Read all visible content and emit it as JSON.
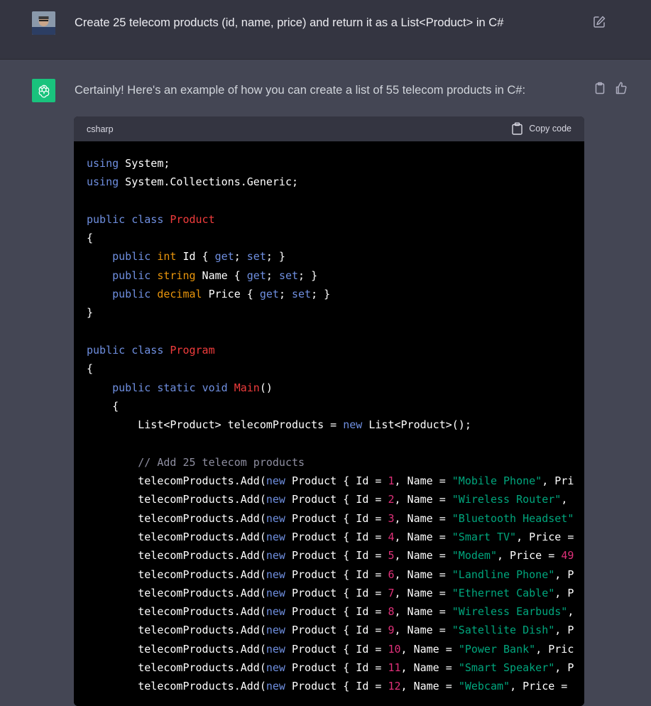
{
  "user": {
    "message": "Create 25 telecom products (id, name, price) and return it as a List<Product> in C#"
  },
  "assistant": {
    "message": "Certainly! Here's an example of how you can create a list of 55 telecom products in C#:"
  },
  "code_block": {
    "language": "csharp",
    "copy_label": "Copy code",
    "lines": [
      [
        {
          "t": "using",
          "c": "kw"
        },
        {
          "t": " System;",
          "c": ""
        }
      ],
      [
        {
          "t": "using",
          "c": "kw"
        },
        {
          "t": " System.Collections.Generic;",
          "c": ""
        }
      ],
      [],
      [
        {
          "t": "public",
          "c": "kw"
        },
        {
          "t": " ",
          "c": ""
        },
        {
          "t": "class",
          "c": "kw"
        },
        {
          "t": " ",
          "c": ""
        },
        {
          "t": "Product",
          "c": "cls"
        }
      ],
      [
        {
          "t": "{",
          "c": ""
        }
      ],
      [
        {
          "t": "    ",
          "c": ""
        },
        {
          "t": "public",
          "c": "kw"
        },
        {
          "t": " ",
          "c": ""
        },
        {
          "t": "int",
          "c": "ty"
        },
        {
          "t": " Id { ",
          "c": ""
        },
        {
          "t": "get",
          "c": "kw"
        },
        {
          "t": "; ",
          "c": ""
        },
        {
          "t": "set",
          "c": "kw"
        },
        {
          "t": "; }",
          "c": ""
        }
      ],
      [
        {
          "t": "    ",
          "c": ""
        },
        {
          "t": "public",
          "c": "kw"
        },
        {
          "t": " ",
          "c": ""
        },
        {
          "t": "string",
          "c": "ty"
        },
        {
          "t": " Name { ",
          "c": ""
        },
        {
          "t": "get",
          "c": "kw"
        },
        {
          "t": "; ",
          "c": ""
        },
        {
          "t": "set",
          "c": "kw"
        },
        {
          "t": "; }",
          "c": ""
        }
      ],
      [
        {
          "t": "    ",
          "c": ""
        },
        {
          "t": "public",
          "c": "kw"
        },
        {
          "t": " ",
          "c": ""
        },
        {
          "t": "decimal",
          "c": "ty"
        },
        {
          "t": " Price { ",
          "c": ""
        },
        {
          "t": "get",
          "c": "kw"
        },
        {
          "t": "; ",
          "c": ""
        },
        {
          "t": "set",
          "c": "kw"
        },
        {
          "t": "; }",
          "c": ""
        }
      ],
      [
        {
          "t": "}",
          "c": ""
        }
      ],
      [],
      [
        {
          "t": "public",
          "c": "kw"
        },
        {
          "t": " ",
          "c": ""
        },
        {
          "t": "class",
          "c": "kw"
        },
        {
          "t": " ",
          "c": ""
        },
        {
          "t": "Program",
          "c": "cls"
        }
      ],
      [
        {
          "t": "{",
          "c": ""
        }
      ],
      [
        {
          "t": "    ",
          "c": ""
        },
        {
          "t": "public",
          "c": "kw"
        },
        {
          "t": " ",
          "c": ""
        },
        {
          "t": "static",
          "c": "kw"
        },
        {
          "t": " ",
          "c": ""
        },
        {
          "t": "void",
          "c": "kw"
        },
        {
          "t": " ",
          "c": ""
        },
        {
          "t": "Main",
          "c": "cls"
        },
        {
          "t": "()",
          "c": ""
        }
      ],
      [
        {
          "t": "    {",
          "c": ""
        }
      ],
      [
        {
          "t": "        List<Product> telecomProducts = ",
          "c": ""
        },
        {
          "t": "new",
          "c": "kw"
        },
        {
          "t": " List<Product>();",
          "c": ""
        }
      ],
      [],
      [
        {
          "t": "        ",
          "c": ""
        },
        {
          "t": "// Add 25 telecom products",
          "c": "cm"
        }
      ],
      [
        {
          "t": "        telecomProducts.Add(",
          "c": ""
        },
        {
          "t": "new",
          "c": "kw"
        },
        {
          "t": " Product { Id = ",
          "c": ""
        },
        {
          "t": "1",
          "c": "num"
        },
        {
          "t": ", Name = ",
          "c": ""
        },
        {
          "t": "\"Mobile Phone\"",
          "c": "str"
        },
        {
          "t": ", Pri",
          "c": ""
        }
      ],
      [
        {
          "t": "        telecomProducts.Add(",
          "c": ""
        },
        {
          "t": "new",
          "c": "kw"
        },
        {
          "t": " Product { Id = ",
          "c": ""
        },
        {
          "t": "2",
          "c": "num"
        },
        {
          "t": ", Name = ",
          "c": ""
        },
        {
          "t": "\"Wireless Router\"",
          "c": "str"
        },
        {
          "t": ",",
          "c": ""
        }
      ],
      [
        {
          "t": "        telecomProducts.Add(",
          "c": ""
        },
        {
          "t": "new",
          "c": "kw"
        },
        {
          "t": " Product { Id = ",
          "c": ""
        },
        {
          "t": "3",
          "c": "num"
        },
        {
          "t": ", Name = ",
          "c": ""
        },
        {
          "t": "\"Bluetooth Headset\"",
          "c": "str"
        }
      ],
      [
        {
          "t": "        telecomProducts.Add(",
          "c": ""
        },
        {
          "t": "new",
          "c": "kw"
        },
        {
          "t": " Product { Id = ",
          "c": ""
        },
        {
          "t": "4",
          "c": "num"
        },
        {
          "t": ", Name = ",
          "c": ""
        },
        {
          "t": "\"Smart TV\"",
          "c": "str"
        },
        {
          "t": ", Price =",
          "c": ""
        }
      ],
      [
        {
          "t": "        telecomProducts.Add(",
          "c": ""
        },
        {
          "t": "new",
          "c": "kw"
        },
        {
          "t": " Product { Id = ",
          "c": ""
        },
        {
          "t": "5",
          "c": "num"
        },
        {
          "t": ", Name = ",
          "c": ""
        },
        {
          "t": "\"Modem\"",
          "c": "str"
        },
        {
          "t": ", Price = ",
          "c": ""
        },
        {
          "t": "49",
          "c": "num"
        }
      ],
      [
        {
          "t": "        telecomProducts.Add(",
          "c": ""
        },
        {
          "t": "new",
          "c": "kw"
        },
        {
          "t": " Product { Id = ",
          "c": ""
        },
        {
          "t": "6",
          "c": "num"
        },
        {
          "t": ", Name = ",
          "c": ""
        },
        {
          "t": "\"Landline Phone\"",
          "c": "str"
        },
        {
          "t": ", P",
          "c": ""
        }
      ],
      [
        {
          "t": "        telecomProducts.Add(",
          "c": ""
        },
        {
          "t": "new",
          "c": "kw"
        },
        {
          "t": " Product { Id = ",
          "c": ""
        },
        {
          "t": "7",
          "c": "num"
        },
        {
          "t": ", Name = ",
          "c": ""
        },
        {
          "t": "\"Ethernet Cable\"",
          "c": "str"
        },
        {
          "t": ", P",
          "c": ""
        }
      ],
      [
        {
          "t": "        telecomProducts.Add(",
          "c": ""
        },
        {
          "t": "new",
          "c": "kw"
        },
        {
          "t": " Product { Id = ",
          "c": ""
        },
        {
          "t": "8",
          "c": "num"
        },
        {
          "t": ", Name = ",
          "c": ""
        },
        {
          "t": "\"Wireless Earbuds\"",
          "c": "str"
        },
        {
          "t": ",",
          "c": ""
        }
      ],
      [
        {
          "t": "        telecomProducts.Add(",
          "c": ""
        },
        {
          "t": "new",
          "c": "kw"
        },
        {
          "t": " Product { Id = ",
          "c": ""
        },
        {
          "t": "9",
          "c": "num"
        },
        {
          "t": ", Name = ",
          "c": ""
        },
        {
          "t": "\"Satellite Dish\"",
          "c": "str"
        },
        {
          "t": ", P",
          "c": ""
        }
      ],
      [
        {
          "t": "        telecomProducts.Add(",
          "c": ""
        },
        {
          "t": "new",
          "c": "kw"
        },
        {
          "t": " Product { Id = ",
          "c": ""
        },
        {
          "t": "10",
          "c": "num"
        },
        {
          "t": ", Name = ",
          "c": ""
        },
        {
          "t": "\"Power Bank\"",
          "c": "str"
        },
        {
          "t": ", Pric",
          "c": ""
        }
      ],
      [
        {
          "t": "        telecomProducts.Add(",
          "c": ""
        },
        {
          "t": "new",
          "c": "kw"
        },
        {
          "t": " Product { Id = ",
          "c": ""
        },
        {
          "t": "11",
          "c": "num"
        },
        {
          "t": ", Name = ",
          "c": ""
        },
        {
          "t": "\"Smart Speaker\"",
          "c": "str"
        },
        {
          "t": ", P",
          "c": ""
        }
      ],
      [
        {
          "t": "        telecomProducts.Add(",
          "c": ""
        },
        {
          "t": "new",
          "c": "kw"
        },
        {
          "t": " Product { Id = ",
          "c": ""
        },
        {
          "t": "12",
          "c": "num"
        },
        {
          "t": ", Name = ",
          "c": ""
        },
        {
          "t": "\"Webcam\"",
          "c": "str"
        },
        {
          "t": ", Price =",
          "c": ""
        }
      ]
    ]
  },
  "icons": {
    "user_avatar": "user-avatar-photo",
    "edit": "edit-icon",
    "assistant_avatar": "openai-logo-icon",
    "copy_message": "clipboard-icon",
    "thumbs_up": "thumbs-up-icon",
    "copy_code": "clipboard-icon"
  },
  "colors": {
    "user_bg": "#343541",
    "assistant_bg": "#444654",
    "code_bg": "#000000",
    "code_header_bg": "#343541",
    "assistant_avatar_bg": "#19c37d",
    "keyword": "#6f8fe0",
    "type": "#e9950c",
    "class_name": "#f03c3c",
    "string": "#00a67d",
    "number": "#df3079",
    "comment": "#8e8ea0"
  }
}
